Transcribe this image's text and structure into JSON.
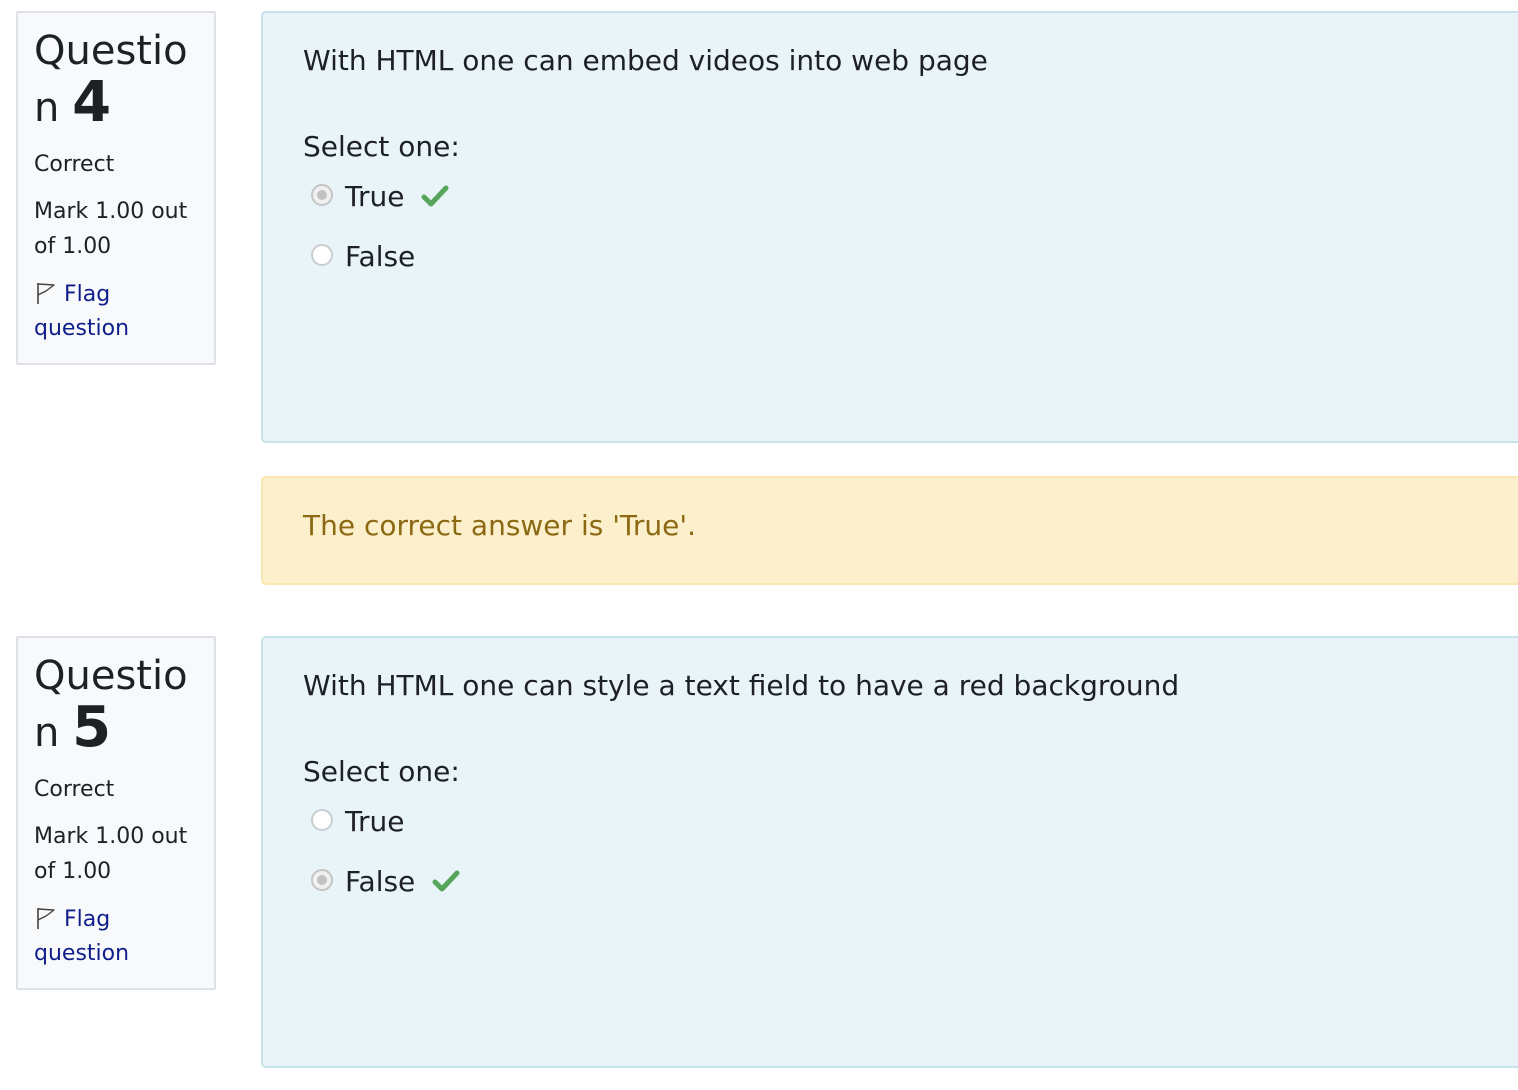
{
  "questions": [
    {
      "label_prefix": "Questio",
      "label_n": "n",
      "number": "4",
      "state": "Correct",
      "grade": "Mark 1.00 out of 1.00",
      "flag_label": "Flag question",
      "text": "With HTML one can embed videos into web page",
      "prompt": "Select one:",
      "options": [
        {
          "label": "True",
          "selected": true,
          "correct_mark": true
        },
        {
          "label": "False",
          "selected": false,
          "correct_mark": false
        }
      ],
      "feedback": "The correct answer is 'True'."
    },
    {
      "label_prefix": "Questio",
      "label_n": "n",
      "number": "5",
      "state": "Correct",
      "grade": "Mark 1.00 out of 1.00",
      "flag_label": "Flag question",
      "text": "With HTML one can style a text field to have a red background",
      "prompt": "Select one:",
      "options": [
        {
          "label": "True",
          "selected": false,
          "correct_mark": false
        },
        {
          "label": "False",
          "selected": true,
          "correct_mark": true
        }
      ]
    }
  ],
  "colors": {
    "info_bg": "#f8f9fa",
    "formulation_bg": "#e8f4f7",
    "feedback_bg": "#fcefcc",
    "feedback_text": "#8c6a14",
    "link": "#0f1e8a",
    "check": "#57a55a"
  },
  "icons": {
    "flag": "flag-icon",
    "correct": "check-icon"
  }
}
